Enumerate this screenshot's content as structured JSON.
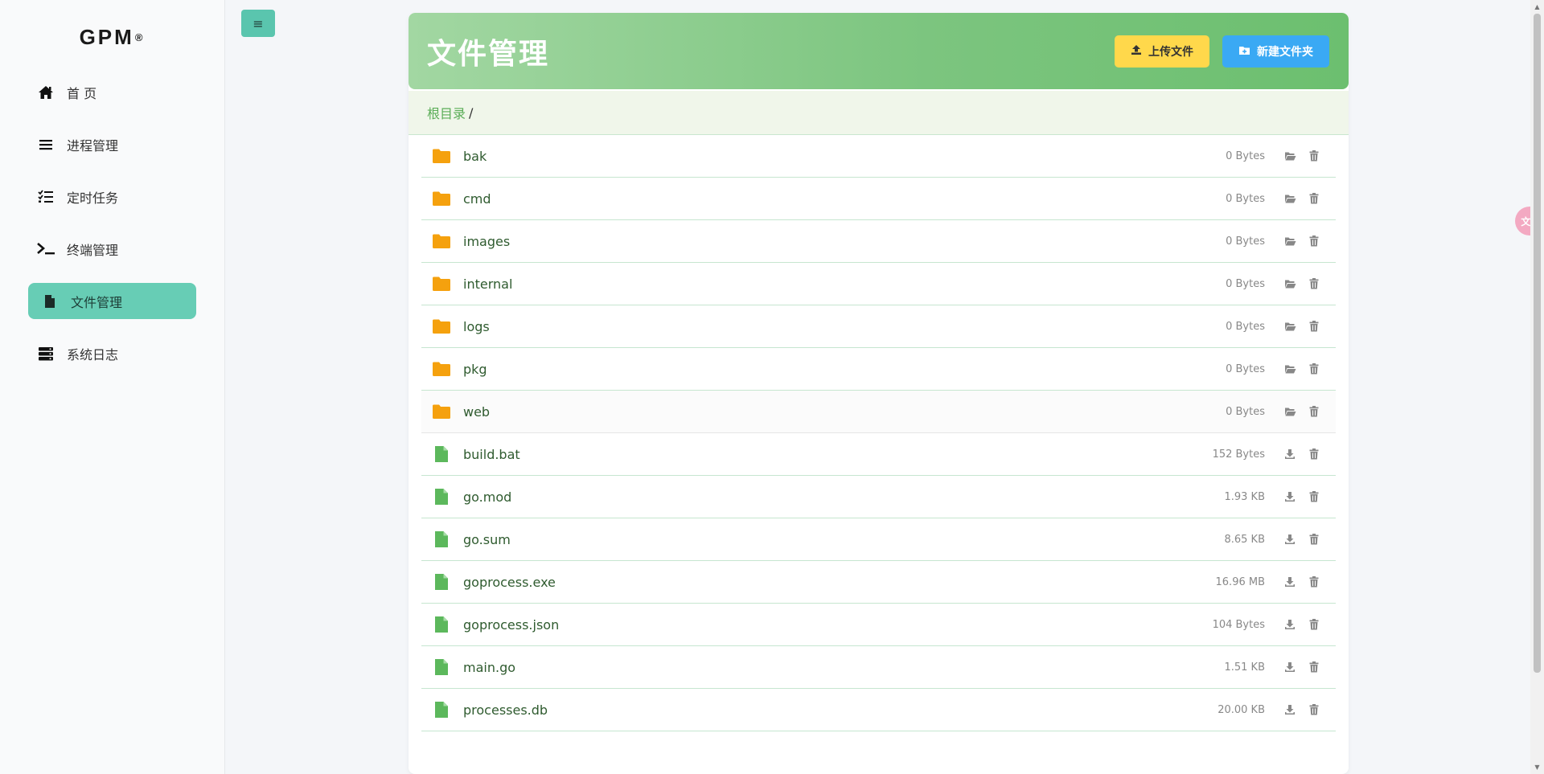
{
  "sidebar": {
    "brand": "GPM",
    "brand_mark": "®",
    "items": [
      {
        "label": "首 页",
        "icon": "home-icon"
      },
      {
        "label": "进程管理",
        "icon": "list-icon"
      },
      {
        "label": "定时任务",
        "icon": "tasklist-icon"
      },
      {
        "label": "终端管理",
        "icon": "terminal-icon"
      },
      {
        "label": "文件管理",
        "icon": "file-icon",
        "active": true
      },
      {
        "label": "系统日志",
        "icon": "server-icon"
      }
    ]
  },
  "toolbar": {
    "toggle_glyph": "≡"
  },
  "panel": {
    "title": "文件管理",
    "upload_label": "上传文件",
    "new_folder_label": "新建文件夹"
  },
  "breadcrumb": {
    "root": "根目录",
    "sep": "/"
  },
  "files": [
    {
      "name": "bak",
      "size": "0 Bytes",
      "type": "folder"
    },
    {
      "name": "cmd",
      "size": "0 Bytes",
      "type": "folder"
    },
    {
      "name": "images",
      "size": "0 Bytes",
      "type": "folder"
    },
    {
      "name": "internal",
      "size": "0 Bytes",
      "type": "folder"
    },
    {
      "name": "logs",
      "size": "0 Bytes",
      "type": "folder"
    },
    {
      "name": "pkg",
      "size": "0 Bytes",
      "type": "folder"
    },
    {
      "name": "web",
      "size": "0 Bytes",
      "type": "folder"
    },
    {
      "name": "build.bat",
      "size": "152 Bytes",
      "type": "file"
    },
    {
      "name": "go.mod",
      "size": "1.93 KB",
      "type": "file"
    },
    {
      "name": "go.sum",
      "size": "8.65 KB",
      "type": "file"
    },
    {
      "name": "goprocess.exe",
      "size": "16.96 MB",
      "type": "file"
    },
    {
      "name": "goprocess.json",
      "size": "104 Bytes",
      "type": "file"
    },
    {
      "name": "main.go",
      "size": "1.51 KB",
      "type": "file"
    },
    {
      "name": "processes.db",
      "size": "20.00 KB",
      "type": "file"
    }
  ],
  "translate": {
    "glyph": "文A"
  },
  "colors": {
    "accent": "#67cdb5",
    "folder": "#f5a10e",
    "file": "#5cb85c",
    "header_start": "#a2d7a2",
    "header_end": "#6cbf6f",
    "upload_btn": "#ffd84b",
    "new_btn": "#3aa9f4"
  }
}
